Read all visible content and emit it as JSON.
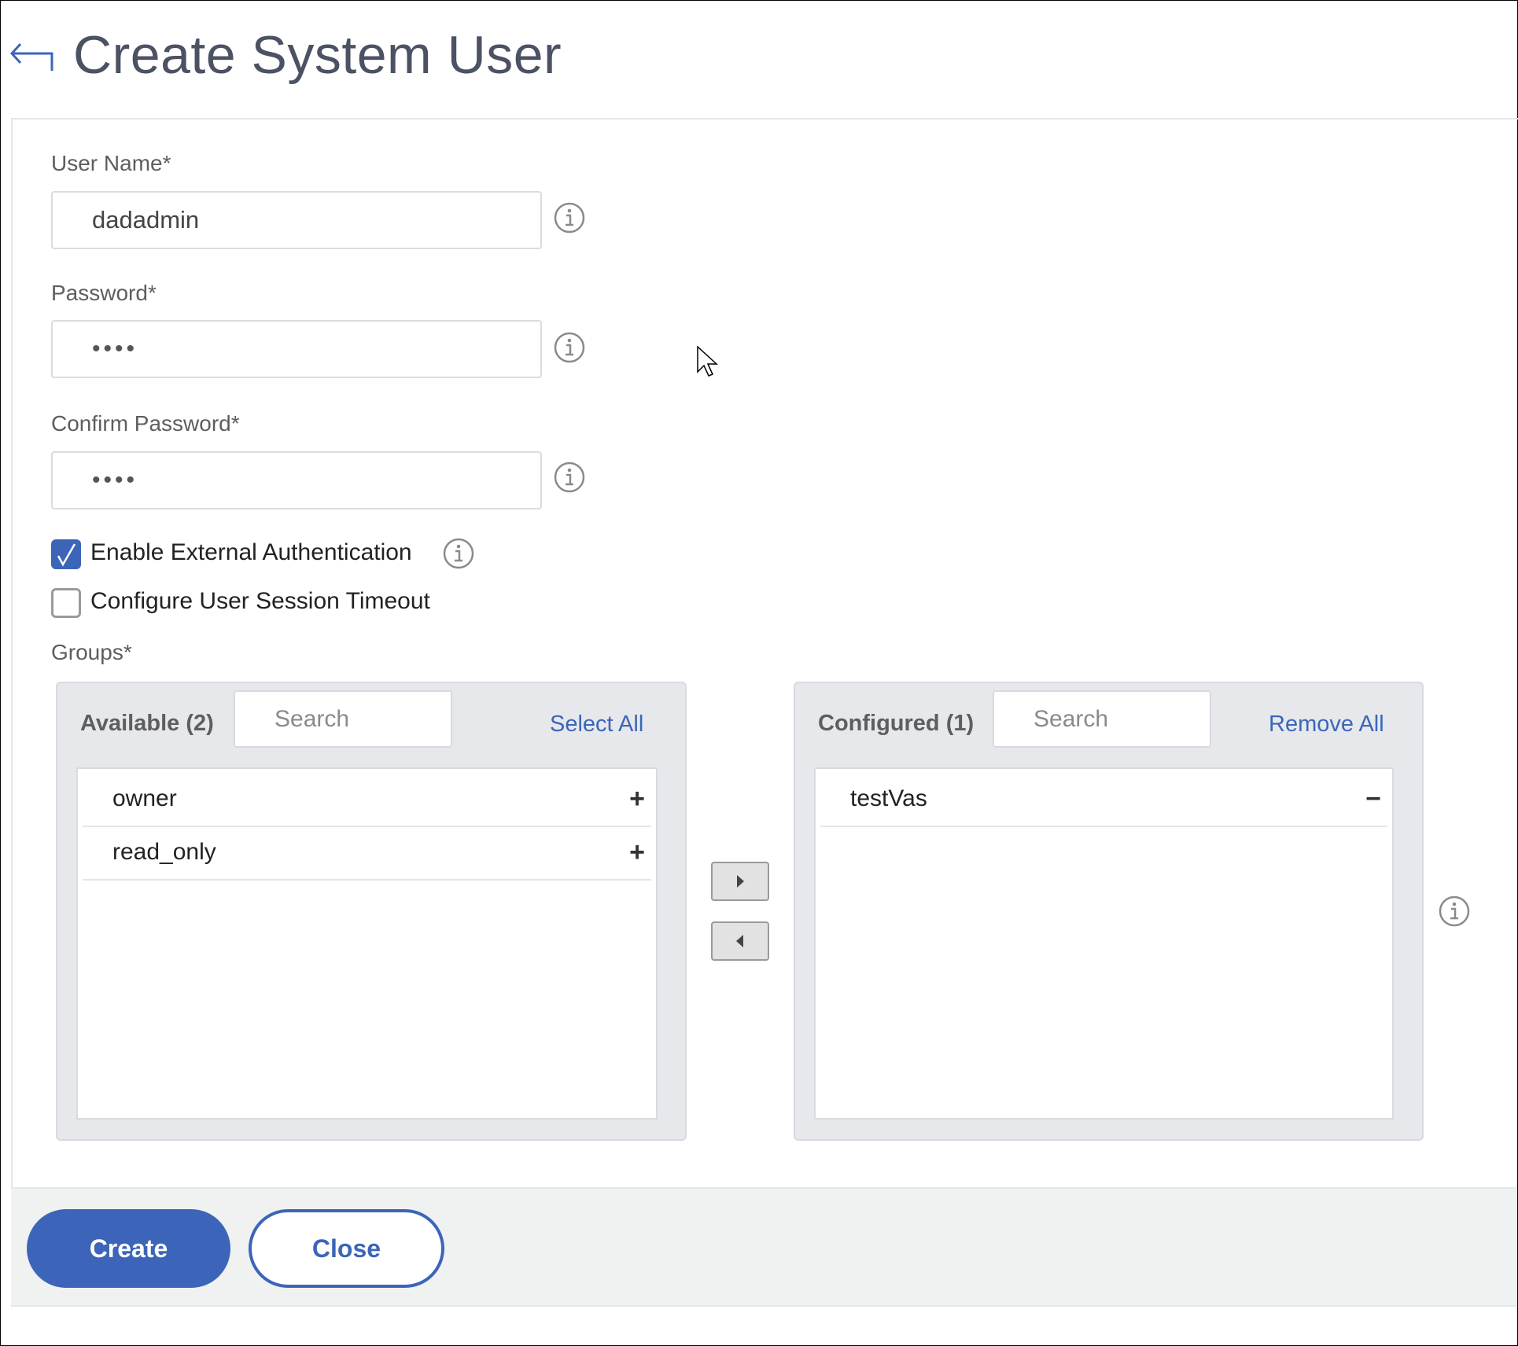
{
  "header": {
    "title": "Create System User",
    "back_icon": "back-arrow-icon"
  },
  "form": {
    "username": {
      "label": "User Name*",
      "value": "dadadmin"
    },
    "password": {
      "label": "Password*",
      "value": "••••"
    },
    "confirm_password": {
      "label": "Confirm Password*",
      "value": "••••"
    },
    "external_auth": {
      "label": "Enable External Authentication",
      "checked": true
    },
    "session_timeout": {
      "label": "Configure User Session Timeout",
      "checked": false
    },
    "groups": {
      "label": "Groups*",
      "available": {
        "title": "Available (2)",
        "search_placeholder": "Search",
        "action": "Select All",
        "items": [
          {
            "label": "owner",
            "action": "+"
          },
          {
            "label": "read_only",
            "action": "+"
          }
        ]
      },
      "configured": {
        "title": "Configured (1)",
        "search_placeholder": "Search",
        "action": "Remove All",
        "items": [
          {
            "label": "testVas",
            "action": "−"
          }
        ]
      }
    }
  },
  "footer": {
    "create_label": "Create",
    "close_label": "Close"
  },
  "colors": {
    "accent": "#3c65b9",
    "title": "#4a5263",
    "panel_bg": "#e6e8ec",
    "footer_bg": "#f0f1f1"
  }
}
